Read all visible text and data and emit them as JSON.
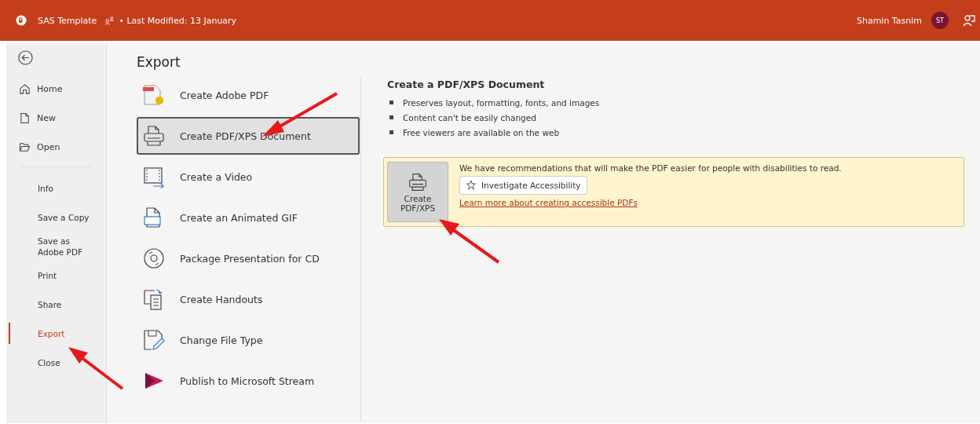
{
  "title_bar": {
    "document": "SAS Template",
    "modified": "• Last Modified: 13 January",
    "user": "Shamin Tasnim",
    "initials": "ST"
  },
  "nav": {
    "top": [
      {
        "label": "Home"
      },
      {
        "label": "New"
      },
      {
        "label": "Open"
      }
    ],
    "items": [
      {
        "label": "Info",
        "selected": false
      },
      {
        "label": "Save a Copy",
        "selected": false
      },
      {
        "label": "Save as Adobe PDF",
        "selected": false
      },
      {
        "label": "Print",
        "selected": false
      },
      {
        "label": "Share",
        "selected": false
      },
      {
        "label": "Export",
        "selected": true
      },
      {
        "label": "Close",
        "selected": false
      }
    ]
  },
  "export": {
    "title": "Export",
    "options": [
      {
        "label": "Create Adobe PDF",
        "selected": false
      },
      {
        "label": "Create PDF/XPS Document",
        "selected": true
      },
      {
        "label": "Create a Video",
        "selected": false
      },
      {
        "label": "Create an Animated GIF",
        "selected": false
      },
      {
        "label": "Package Presentation for CD",
        "selected": false
      },
      {
        "label": "Create Handouts",
        "selected": false
      },
      {
        "label": "Change File Type",
        "selected": false
      },
      {
        "label": "Publish to Microsoft Stream",
        "selected": false
      }
    ]
  },
  "detail": {
    "title": "Create a PDF/XPS Document",
    "bullets": [
      "Preserves layout, formatting, fonts, and images",
      "Content can't be easily changed",
      "Free viewers are available on the web"
    ],
    "create_button": "Create PDF/XPS",
    "recommendation": "We have recommendations that will make the PDF easier for people with disabilities to read.",
    "accessibility_button": "Investigate Accessibility",
    "link": "Learn more about creating accessible PDFs"
  }
}
